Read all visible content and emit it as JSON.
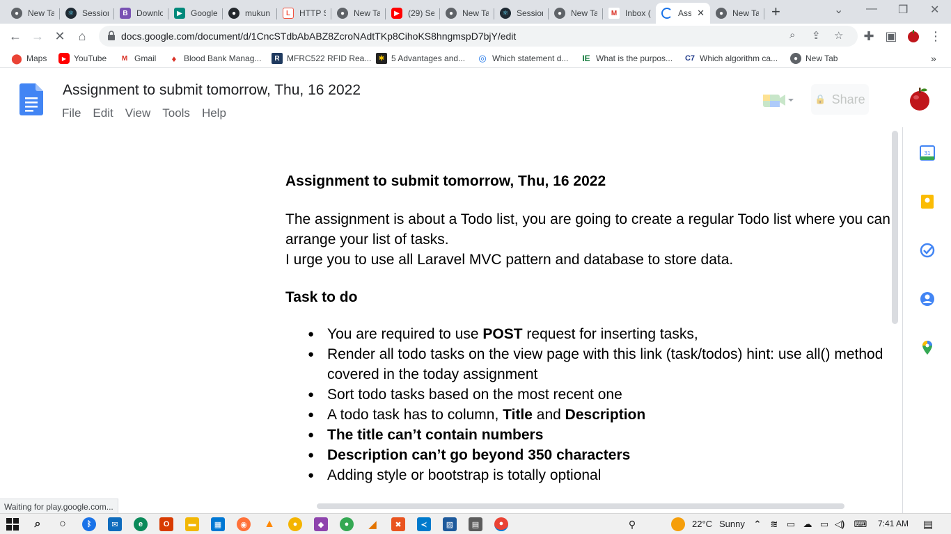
{
  "browser": {
    "tabs": [
      {
        "label": "New Ta",
        "icon": "chrome-icon"
      },
      {
        "label": "Session",
        "icon": "react-icon"
      },
      {
        "label": "Downlo",
        "icon": "bootstrap-icon"
      },
      {
        "label": "Google",
        "icon": "meet-icon"
      },
      {
        "label": "mukun",
        "icon": "github-icon"
      },
      {
        "label": "HTTP S",
        "icon": "laravel-icon"
      },
      {
        "label": "New Ta",
        "icon": "chrome-icon"
      },
      {
        "label": "(29) Se",
        "icon": "youtube-icon"
      },
      {
        "label": "New Ta",
        "icon": "chrome-icon"
      },
      {
        "label": "Session",
        "icon": "react-icon"
      },
      {
        "label": "New Ta",
        "icon": "chrome-icon"
      },
      {
        "label": "Inbox (",
        "icon": "gmail-icon"
      },
      {
        "label": "Ass",
        "icon": "loading-icon",
        "active": true
      },
      {
        "label": "New Ta",
        "icon": "chrome-icon"
      }
    ],
    "url": "docs.google.com/document/d/1CncSTdbAbABZ8ZcroNAdtTKp8CihoKS8hngmspD7bjY/edit",
    "bookmarks": [
      {
        "label": "Maps",
        "icon": "maps-icon"
      },
      {
        "label": "YouTube",
        "icon": "youtube-icon"
      },
      {
        "label": "Gmail",
        "icon": "gmail-icon"
      },
      {
        "label": "Blood Bank Manag...",
        "icon": "blood-drop-icon"
      },
      {
        "label": "MFRC522 RFID Rea...",
        "icon": "r-icon"
      },
      {
        "label": "5 Advantages and...",
        "icon": "bee-icon"
      },
      {
        "label": "Which statement d...",
        "icon": "globe-icon"
      },
      {
        "label": "What is the purpos...",
        "icon": "ie-icon"
      },
      {
        "label": "Which algorithm ca...",
        "icon": "c7-icon"
      },
      {
        "label": "New Tab",
        "icon": "chrome-icon"
      }
    ],
    "status": "Waiting for play.google.com..."
  },
  "docs": {
    "title": "Assignment to submit tomorrow, Thu, 16 2022",
    "menu": [
      "File",
      "Edit",
      "View",
      "Tools",
      "Help"
    ],
    "share_label": "Share"
  },
  "document": {
    "heading": "Assignment to submit tomorrow, Thu, 16 2022",
    "para1": "The assignment is about a Todo list, you are going to create a regular Todo list where you can arrange your list of tasks.",
    "para2": "I urge you to use all Laravel MVC pattern and database to store data.",
    "subheading": "Task to do",
    "bullets": {
      "b1_pre": "You are required to use ",
      "b1_bold": "POST",
      "b1_post": " request for inserting tasks,",
      "b2": "Render all todo tasks on the view page with this link (task/todos) hint: use all() method covered in the today assignment",
      "b3": "Sort todo tasks based on the most recent one",
      "b4_pre": "A todo task has to column, ",
      "b4_bold1": "Title",
      "b4_mid": " and ",
      "b4_bold2": "Description",
      "b5": "The title can’t contain numbers",
      "b6": "Description can’t go beyond 350 characters",
      "b7": "Adding style or bootstrap is totally optional"
    }
  },
  "taskbar": {
    "temperature": "22°C",
    "weather": "Sunny",
    "time": "7:41 AM"
  },
  "colors": {
    "accent": "#1a73e8",
    "docs_blue": "#4285f4",
    "tabstrip": "#dee1e6"
  }
}
